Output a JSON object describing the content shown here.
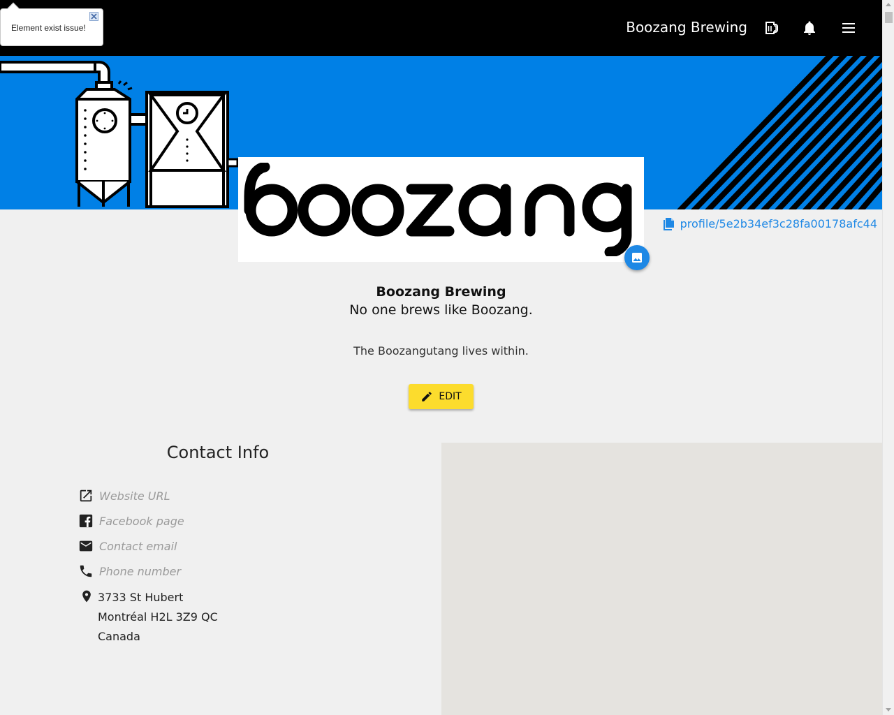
{
  "header": {
    "brand": "Boozang Brewing",
    "icons": [
      "beer-icon",
      "bell-icon",
      "menu-icon"
    ]
  },
  "banner": {
    "color": "#0080e6"
  },
  "logo": {
    "text": "boozang"
  },
  "profile_link": {
    "text": "profile/5e2b34ef3c28fa00178afc44"
  },
  "profile": {
    "name": "Boozang Brewing",
    "tagline": "No one brews like Boozang.",
    "description": "The Boozangutang lives within."
  },
  "edit_button": {
    "label": "EDIT",
    "color": "#fcdc2d"
  },
  "contact": {
    "title": "Contact Info",
    "website_placeholder": "Website URL",
    "facebook_placeholder": "Facebook page",
    "email_placeholder": "Contact email",
    "phone_placeholder": "Phone number",
    "address_line1": "3733 St Hubert",
    "address_line2": "Montréal H2L 3Z9 QC",
    "address_line3": "Canada"
  },
  "toast": {
    "message": "Element exist issue!"
  },
  "colors": {
    "accent": "#1e88e5",
    "topbar": "#000000",
    "map": "#e5e3df"
  }
}
